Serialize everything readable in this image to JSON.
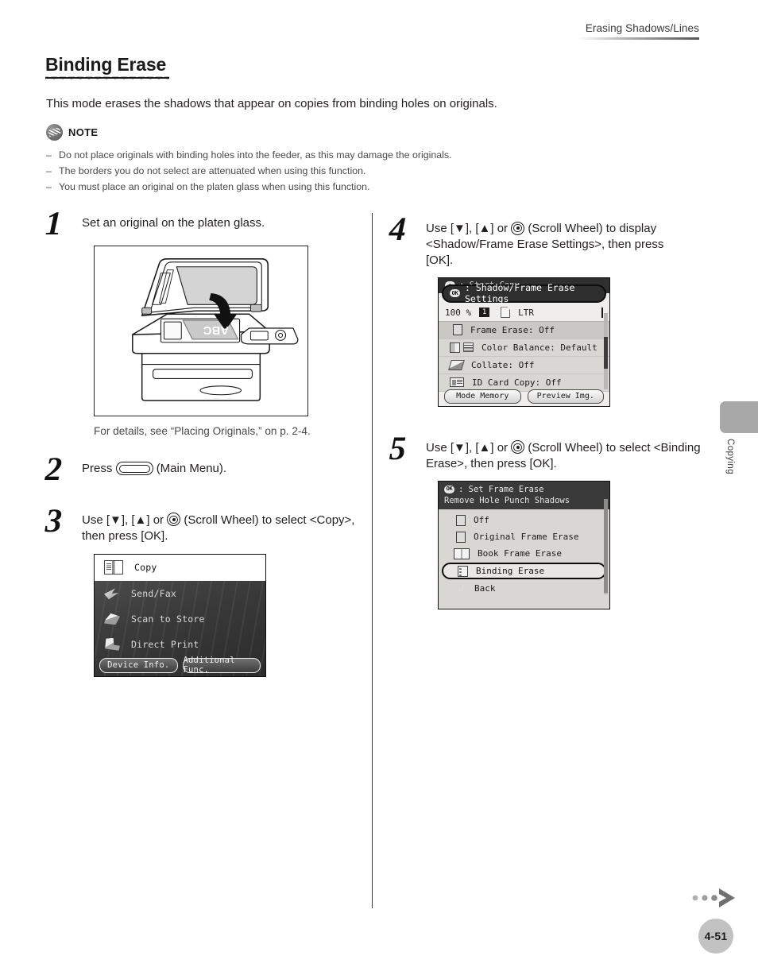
{
  "header": {
    "running_head": "Erasing Shadows/Lines"
  },
  "title": "Binding Erase",
  "intro": "This mode erases the shadows that appear on copies from binding holes on originals.",
  "note": {
    "label": "NOTE",
    "items": [
      "Do not place originals with binding holes into the feeder, as this may damage the originals.",
      "The borders you do not select are attenuated when using this function.",
      "You must place an original on the platen glass when using this function."
    ]
  },
  "steps": {
    "s1": {
      "num": "1",
      "text": "Set an original on the platen glass.",
      "caption": "For details, see “Placing Originals,” on p. 2-4.",
      "figure_label": "ABC"
    },
    "s2": {
      "num": "2",
      "pre": "Press",
      "post": "(Main Menu)."
    },
    "s3": {
      "num": "3",
      "pre": "Use [▼], [▲] or",
      "post": "(Scroll Wheel) to select <Copy>, then press [OK]."
    },
    "s4": {
      "num": "4",
      "pre": "Use [▼], [▲] or",
      "post": "(Scroll Wheel) to display <Shadow/Frame Erase Settings>, then press [OK]."
    },
    "s5": {
      "num": "5",
      "pre": "Use [▼], [▲] or",
      "post": "(Scroll Wheel) to select <Binding Erase>, then press [OK]."
    }
  },
  "lcd_main_menu": {
    "rows": [
      {
        "label": "Copy",
        "icon": "copy-icon",
        "selected": true
      },
      {
        "label": "Send/Fax",
        "icon": "send-fax-icon",
        "selected": false
      },
      {
        "label": "Scan to Store",
        "icon": "scan-to-store-icon",
        "selected": false
      },
      {
        "label": "Direct Print",
        "icon": "direct-print-icon",
        "selected": false
      }
    ],
    "buttons": [
      "Device Info.",
      "Additional Func."
    ]
  },
  "lcd_copy_settings": {
    "top_partial": ": Start Copy",
    "selected_banner": ": Shadow/Frame Erase Settings",
    "ok_badge": "OK",
    "info": {
      "zoom": "100 %",
      "copies": "1",
      "paper": "LTR"
    },
    "rows": [
      {
        "label": "Frame Erase: Off",
        "icon": "page-icon"
      },
      {
        "label": "Color Balance: Default",
        "icon": "color-balance-icon"
      },
      {
        "label": "Collate: Off",
        "icon": "collate-icon"
      },
      {
        "label": "ID Card Copy: Off",
        "icon": "id-card-icon"
      }
    ],
    "buttons": [
      "Mode Memory",
      "Preview Img."
    ]
  },
  "lcd_frame_erase": {
    "ok_badge": "OK",
    "title_line1": ": Set Frame Erase",
    "title_line2": "Remove Hole Punch Shadows",
    "rows": [
      {
        "label": "Off",
        "icon": "page-icon",
        "selected": false
      },
      {
        "label": "Original Frame Erase",
        "icon": "page-icon",
        "selected": false
      },
      {
        "label": "Book Frame Erase",
        "icon": "book-icon",
        "selected": false
      },
      {
        "label": "Binding Erase",
        "icon": "binding-icon",
        "selected": true
      },
      {
        "label": "Back",
        "icon": "back-arrow-icon",
        "selected": false
      }
    ]
  },
  "side_tab": {
    "label": "Copying"
  },
  "footer": {
    "page_number": "4-51"
  },
  "colors": {
    "ink": "#231f20",
    "muted": "#4a4a4a",
    "tab_gray": "#a8a8a8",
    "badge_gray": "#c2c2c2"
  }
}
